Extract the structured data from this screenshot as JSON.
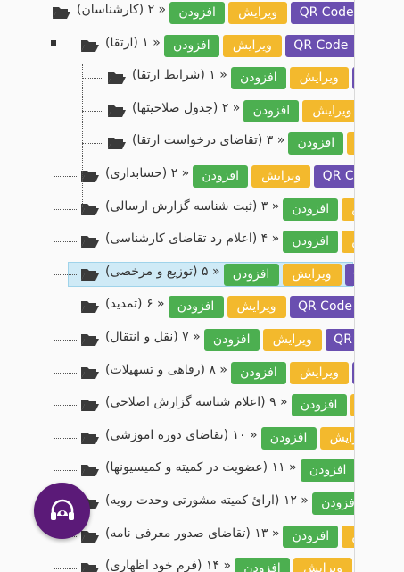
{
  "buttons": {
    "add": "افزودن",
    "edit": "ویرایش",
    "qr": "QR Code"
  },
  "rows": [
    {
      "label": "« ۲ (کارشناسان)",
      "level": 0,
      "add": true,
      "edit": true,
      "qr": true,
      "pink": true
    },
    {
      "label": "« ۱ (ارتقا)",
      "level": 1,
      "add": true,
      "edit": true,
      "qr": true,
      "pink": true
    },
    {
      "label": "« ۱ (شرایط ارتقا)",
      "level": 2,
      "add": true,
      "edit": true,
      "qr": true
    },
    {
      "label": "« ۲ (جدول صلاحیتها)",
      "level": 2,
      "add": true,
      "edit": true
    },
    {
      "label": "« ۳ (تقاضای درخواست ارتقا)",
      "level": 2,
      "add": true,
      "edit": true
    },
    {
      "label": "« ۲ (حسابداری)",
      "level": 1,
      "add": true,
      "edit": true,
      "qr": true
    },
    {
      "label": "« ۳ (ثبت شناسه گزارش ارسالی)",
      "level": 1,
      "add": true,
      "edit": true
    },
    {
      "label": "« ۴ (اعلام رد تقاضای کارشناسی)",
      "level": 1,
      "add": true,
      "edit": true
    },
    {
      "label": "« ۵ (توزیع و مرخصی)",
      "level": 1,
      "add": true,
      "edit": true,
      "qr": true,
      "selected": true
    },
    {
      "label": "« ۶ (تمدید)",
      "level": 1,
      "add": true,
      "edit": true,
      "qr": true
    },
    {
      "label": "« ۷ (نقل و انتقال)",
      "level": 1,
      "add": true,
      "edit": true,
      "qr": true
    },
    {
      "label": "« ۸ (رفاهی و تسهیلات)",
      "level": 1,
      "add": true,
      "edit": true,
      "qr": true
    },
    {
      "label": "« ۹ (اعلام شناسه گزارش اصلاحی)",
      "level": 1,
      "add": true,
      "edit": true
    },
    {
      "label": "« ۱۰ (تقاضای دوره اموزشی)",
      "level": 1,
      "add": true,
      "edit": true
    },
    {
      "label": "« ۱۱ (عضویت در کمیته و کمیسیونها)",
      "level": 1,
      "add": true,
      "edit": true
    },
    {
      "label": "« ۱۲ (ارائ کمیته مشورتی وحدت رویه)",
      "level": 1,
      "add": true,
      "edit": true
    },
    {
      "label": "« ۱۳ (تقاضای صدور معرفی نامه)",
      "level": 1,
      "add": true,
      "edit": true
    },
    {
      "label": "« ۱۴ (فرم خود اظهاری)",
      "level": 1,
      "add": true,
      "edit": true,
      "qr": true
    }
  ],
  "colors": {
    "add": "#4caf50",
    "edit": "#f3b92d",
    "qr": "#6a4fb0",
    "pink": "#e83e8c",
    "fab": "#5b1a78"
  },
  "icons": {
    "folder": "folder-open-icon",
    "fab": "headset-support-icon"
  }
}
